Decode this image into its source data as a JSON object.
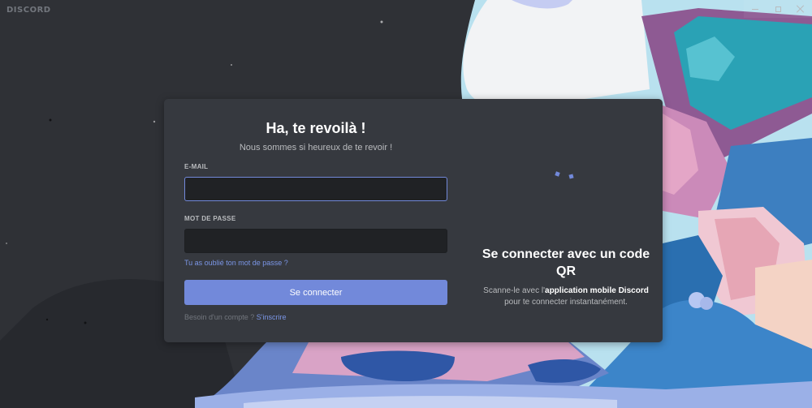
{
  "app": {
    "brand": "DISCORD"
  },
  "login": {
    "title": "Ha, te revoilà !",
    "subtitle": "Nous sommes si heureux de te revoir !",
    "email_label": "E-MAIL",
    "email_value": "",
    "password_label": "MOT DE PASSE",
    "password_value": "",
    "forgot_password": "Tu as oublié ton mot de passe ?",
    "submit_label": "Se connecter",
    "register_prompt": "Besoin d'un compte ?",
    "register_link": "S'inscrire"
  },
  "qr": {
    "title": "Se connecter avec un code QR",
    "desc_part1": "Scanne-le avec l'",
    "desc_bold": "application mobile Discord",
    "desc_part2": " pour te connecter instantanément."
  },
  "colors": {
    "accent": "#7289da",
    "modal_bg": "#36393f",
    "input_bg": "#202225",
    "link": "#7b96e6",
    "background_dark": "#2f3136"
  },
  "icons": {
    "minimize": "minimize-icon",
    "maximize": "maximize-icon",
    "close": "close-icon"
  }
}
